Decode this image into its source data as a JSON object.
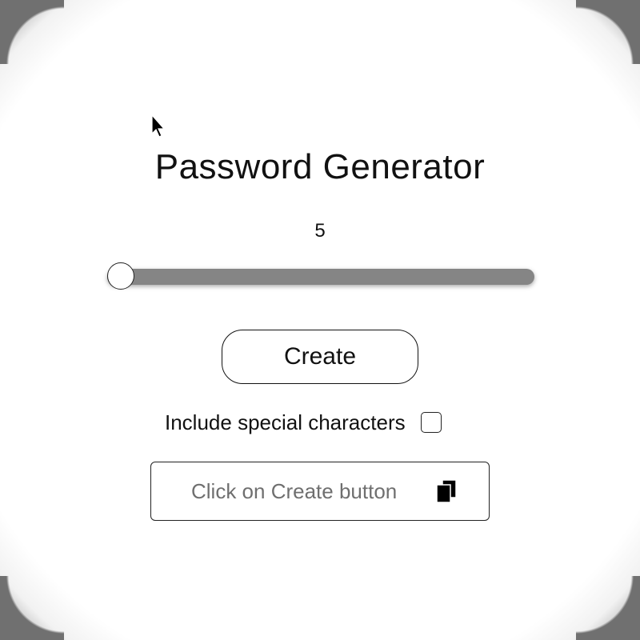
{
  "app": {
    "title": "Password Generator"
  },
  "slider": {
    "value": 5,
    "value_label": "5",
    "min": 5,
    "max": 20,
    "fraction": 0.0
  },
  "create_button": {
    "label": "Create"
  },
  "options": {
    "special_characters_label": "Include special characters",
    "special_characters_checked": false
  },
  "output": {
    "placeholder": "Click on Create button",
    "copy_icon": "copy-icon"
  },
  "colors": {
    "text": "#111111",
    "track": "#858585",
    "placeholder": "#6f6f6f",
    "background": "#ffffff"
  }
}
